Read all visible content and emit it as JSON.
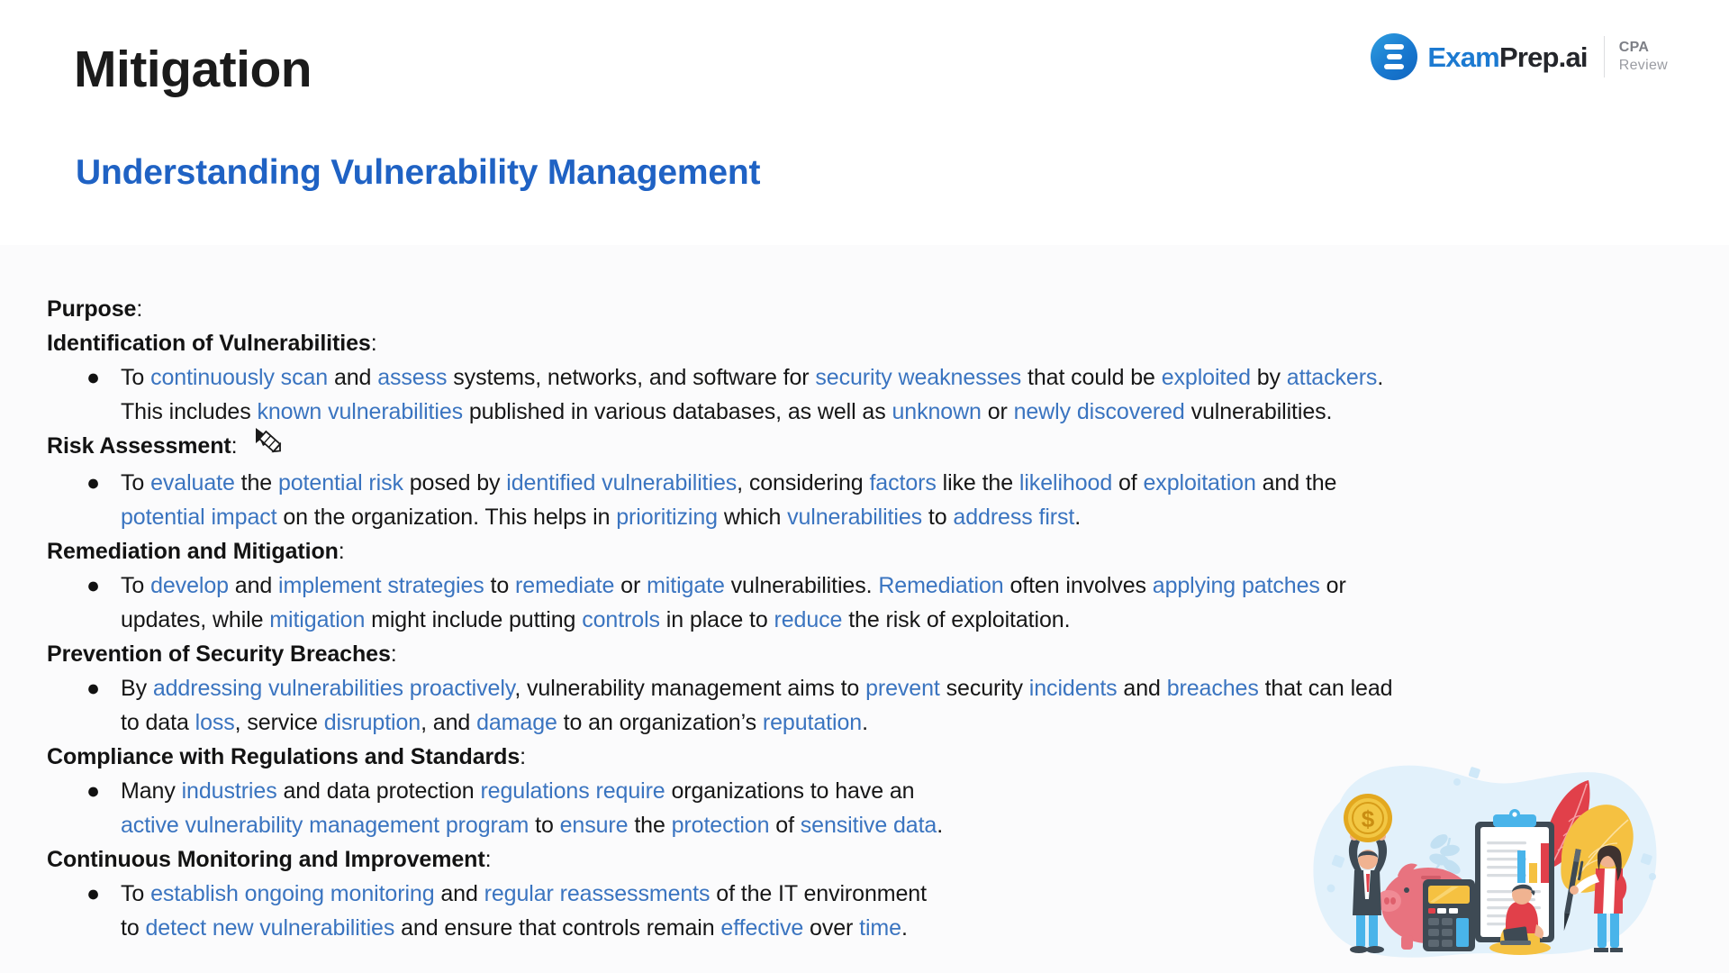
{
  "header": {
    "title": "Mitigation",
    "subtitle": "Understanding Vulnerability Management",
    "logo": {
      "icon_name": "examprep-bars-icon",
      "word_primary": "Exam",
      "word_secondary": "Prep.ai",
      "sub_top": "CPA",
      "sub_bottom": "Review"
    }
  },
  "colors": {
    "title": "#1b1b1b",
    "subtitle_blue": "#1f62c4",
    "body_link_blue": "#3a74c0",
    "body_text": "#161616",
    "body_background": "#fbfbfc",
    "header_background": "#ffffff",
    "logo_blue": "#1c7ad1",
    "logo_gray": "#8d8f95"
  },
  "cursor": {
    "icon_name": "pencil-cursor-icon",
    "visible": true
  },
  "body": {
    "purpose_label": "Purpose",
    "sections": [
      {
        "heading": "Identification of Vulnerabilities",
        "bullet": {
          "marker": "●",
          "lines": [
            [
              {
                "t": "To ",
                "hl": false
              },
              {
                "t": "continuously scan",
                "hl": true
              },
              {
                "t": " and ",
                "hl": false
              },
              {
                "t": "assess",
                "hl": true
              },
              {
                "t": " systems, networks, and software for ",
                "hl": false
              },
              {
                "t": "security weaknesses",
                "hl": true
              },
              {
                "t": " that could be ",
                "hl": false
              },
              {
                "t": "exploited",
                "hl": true
              },
              {
                "t": " by ",
                "hl": false
              },
              {
                "t": "attackers",
                "hl": true
              },
              {
                "t": ".",
                "hl": false
              }
            ],
            [
              {
                "t": "This includes ",
                "hl": false
              },
              {
                "t": "known vulnerabilities",
                "hl": true
              },
              {
                "t": " published in various databases, as well as ",
                "hl": false
              },
              {
                "t": "unknown",
                "hl": true
              },
              {
                "t": " or ",
                "hl": false
              },
              {
                "t": "newly discovered",
                "hl": true
              },
              {
                "t": " vulnerabilities.",
                "hl": false
              }
            ]
          ]
        }
      },
      {
        "heading": "Risk Assessment",
        "bullet": {
          "marker": "●",
          "lines": [
            [
              {
                "t": "To ",
                "hl": false
              },
              {
                "t": "evaluate",
                "hl": true
              },
              {
                "t": " the ",
                "hl": false
              },
              {
                "t": "potential risk",
                "hl": true
              },
              {
                "t": " posed by ",
                "hl": false
              },
              {
                "t": "identified vulnerabilities",
                "hl": true
              },
              {
                "t": ", considering ",
                "hl": false
              },
              {
                "t": "factors",
                "hl": true
              },
              {
                "t": " like the ",
                "hl": false
              },
              {
                "t": "likelihood",
                "hl": true
              },
              {
                "t": " of ",
                "hl": false
              },
              {
                "t": "exploitation",
                "hl": true
              },
              {
                "t": " and the",
                "hl": false
              }
            ],
            [
              {
                "t": "potential impact",
                "hl": true
              },
              {
                "t": " on the organization. This helps in ",
                "hl": false
              },
              {
                "t": "prioritizing",
                "hl": true
              },
              {
                "t": " which ",
                "hl": false
              },
              {
                "t": "vulnerabilities",
                "hl": true
              },
              {
                "t": " to ",
                "hl": false
              },
              {
                "t": "address first",
                "hl": true
              },
              {
                "t": ".",
                "hl": false
              }
            ]
          ]
        }
      },
      {
        "heading": "Remediation and Mitigation",
        "bullet": {
          "marker": "●",
          "lines": [
            [
              {
                "t": "To ",
                "hl": false
              },
              {
                "t": "develop",
                "hl": true
              },
              {
                "t": " and ",
                "hl": false
              },
              {
                "t": "implement strategies",
                "hl": true
              },
              {
                "t": " to ",
                "hl": false
              },
              {
                "t": "remediate",
                "hl": true
              },
              {
                "t": " or ",
                "hl": false
              },
              {
                "t": "mitigate",
                "hl": true
              },
              {
                "t": " vulnerabilities. ",
                "hl": false
              },
              {
                "t": "Remediation",
                "hl": true
              },
              {
                "t": " often involves ",
                "hl": false
              },
              {
                "t": "applying patches",
                "hl": true
              },
              {
                "t": " or",
                "hl": false
              }
            ],
            [
              {
                "t": "updates, while ",
                "hl": false
              },
              {
                "t": "mitigation",
                "hl": true
              },
              {
                "t": " might include putting ",
                "hl": false
              },
              {
                "t": "controls",
                "hl": true
              },
              {
                "t": " in place to ",
                "hl": false
              },
              {
                "t": "reduce",
                "hl": true
              },
              {
                "t": " the risk of exploitation.",
                "hl": false
              }
            ]
          ]
        }
      },
      {
        "heading": "Prevention of Security Breaches",
        "bullet": {
          "marker": "●",
          "lines": [
            [
              {
                "t": "By ",
                "hl": false
              },
              {
                "t": "addressing vulnerabilities proactively",
                "hl": true
              },
              {
                "t": ", vulnerability management aims to ",
                "hl": false
              },
              {
                "t": "prevent",
                "hl": true
              },
              {
                "t": " security ",
                "hl": false
              },
              {
                "t": "incidents",
                "hl": true
              },
              {
                "t": " and ",
                "hl": false
              },
              {
                "t": "breaches",
                "hl": true
              },
              {
                "t": " that can lead",
                "hl": false
              }
            ],
            [
              {
                "t": "to data ",
                "hl": false
              },
              {
                "t": "loss",
                "hl": true
              },
              {
                "t": ", service ",
                "hl": false
              },
              {
                "t": "disruption",
                "hl": true
              },
              {
                "t": ", and ",
                "hl": false
              },
              {
                "t": "damage",
                "hl": true
              },
              {
                "t": " to an organization’s ",
                "hl": false
              },
              {
                "t": "reputation",
                "hl": true
              },
              {
                "t": ".",
                "hl": false
              }
            ]
          ]
        }
      },
      {
        "heading": "Compliance with Regulations and Standards",
        "bullet": {
          "marker": "●",
          "lines": [
            [
              {
                "t": "Many ",
                "hl": false
              },
              {
                "t": "industries",
                "hl": true
              },
              {
                "t": " and data protection ",
                "hl": false
              },
              {
                "t": "regulations require",
                "hl": true
              },
              {
                "t": " organizations to have an",
                "hl": false
              }
            ],
            [
              {
                "t": "active vulnerability management program",
                "hl": true
              },
              {
                "t": " to ",
                "hl": false
              },
              {
                "t": "ensure",
                "hl": true
              },
              {
                "t": " the ",
                "hl": false
              },
              {
                "t": "protection",
                "hl": true
              },
              {
                "t": " of ",
                "hl": false
              },
              {
                "t": "sensitive data",
                "hl": true
              },
              {
                "t": ".",
                "hl": false
              }
            ]
          ]
        }
      },
      {
        "heading": "Continuous Monitoring and Improvement",
        "bullet": {
          "marker": "●",
          "lines": [
            [
              {
                "t": "To ",
                "hl": false
              },
              {
                "t": "establish ongoing monitoring",
                "hl": true
              },
              {
                "t": " and ",
                "hl": false
              },
              {
                "t": "regular reassessments",
                "hl": true
              },
              {
                "t": " of the IT environment",
                "hl": false
              }
            ],
            [
              {
                "t": "to ",
                "hl": false
              },
              {
                "t": "detect new vulnerabilities",
                "hl": true
              },
              {
                "t": " and ensure that controls remain ",
                "hl": false
              },
              {
                "t": "effective",
                "hl": true
              },
              {
                "t": " over ",
                "hl": false
              },
              {
                "t": "time",
                "hl": true
              },
              {
                "t": ".",
                "hl": false
              }
            ]
          ]
        }
      }
    ]
  },
  "illustration": {
    "icon_name": "finance-accounting-illustration",
    "elements": [
      "dollar-coin",
      "piggy-bank",
      "calculator",
      "clipboard-bar-chart",
      "person-with-laptop",
      "pen",
      "red-leaf",
      "yellow-leaf",
      "standing-woman",
      "man-lifting-coin"
    ],
    "palette": {
      "blob": "#e2f1fb",
      "coin": "#f2c744",
      "piggy": "#e8737f",
      "calculator": "#3e4a54",
      "accent_blue": "#49b4ea",
      "accent_red": "#e1404a",
      "accent_yellow": "#f5c141"
    }
  }
}
